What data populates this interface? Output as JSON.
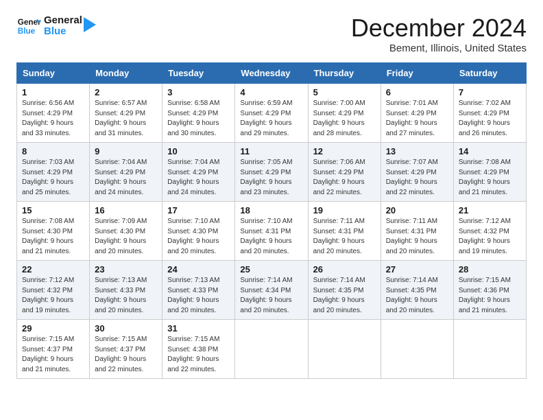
{
  "header": {
    "logo_text_general": "General",
    "logo_text_blue": "Blue",
    "month_title": "December 2024",
    "location": "Bement, Illinois, United States"
  },
  "calendar": {
    "days_of_week": [
      "Sunday",
      "Monday",
      "Tuesday",
      "Wednesday",
      "Thursday",
      "Friday",
      "Saturday"
    ],
    "weeks": [
      [
        {
          "day": "1",
          "info": "Sunrise: 6:56 AM\nSunset: 4:29 PM\nDaylight: 9 hours\nand 33 minutes."
        },
        {
          "day": "2",
          "info": "Sunrise: 6:57 AM\nSunset: 4:29 PM\nDaylight: 9 hours\nand 31 minutes."
        },
        {
          "day": "3",
          "info": "Sunrise: 6:58 AM\nSunset: 4:29 PM\nDaylight: 9 hours\nand 30 minutes."
        },
        {
          "day": "4",
          "info": "Sunrise: 6:59 AM\nSunset: 4:29 PM\nDaylight: 9 hours\nand 29 minutes."
        },
        {
          "day": "5",
          "info": "Sunrise: 7:00 AM\nSunset: 4:29 PM\nDaylight: 9 hours\nand 28 minutes."
        },
        {
          "day": "6",
          "info": "Sunrise: 7:01 AM\nSunset: 4:29 PM\nDaylight: 9 hours\nand 27 minutes."
        },
        {
          "day": "7",
          "info": "Sunrise: 7:02 AM\nSunset: 4:29 PM\nDaylight: 9 hours\nand 26 minutes."
        }
      ],
      [
        {
          "day": "8",
          "info": "Sunrise: 7:03 AM\nSunset: 4:29 PM\nDaylight: 9 hours\nand 25 minutes."
        },
        {
          "day": "9",
          "info": "Sunrise: 7:04 AM\nSunset: 4:29 PM\nDaylight: 9 hours\nand 24 minutes."
        },
        {
          "day": "10",
          "info": "Sunrise: 7:04 AM\nSunset: 4:29 PM\nDaylight: 9 hours\nand 24 minutes."
        },
        {
          "day": "11",
          "info": "Sunrise: 7:05 AM\nSunset: 4:29 PM\nDaylight: 9 hours\nand 23 minutes."
        },
        {
          "day": "12",
          "info": "Sunrise: 7:06 AM\nSunset: 4:29 PM\nDaylight: 9 hours\nand 22 minutes."
        },
        {
          "day": "13",
          "info": "Sunrise: 7:07 AM\nSunset: 4:29 PM\nDaylight: 9 hours\nand 22 minutes."
        },
        {
          "day": "14",
          "info": "Sunrise: 7:08 AM\nSunset: 4:29 PM\nDaylight: 9 hours\nand 21 minutes."
        }
      ],
      [
        {
          "day": "15",
          "info": "Sunrise: 7:08 AM\nSunset: 4:30 PM\nDaylight: 9 hours\nand 21 minutes."
        },
        {
          "day": "16",
          "info": "Sunrise: 7:09 AM\nSunset: 4:30 PM\nDaylight: 9 hours\nand 20 minutes."
        },
        {
          "day": "17",
          "info": "Sunrise: 7:10 AM\nSunset: 4:30 PM\nDaylight: 9 hours\nand 20 minutes."
        },
        {
          "day": "18",
          "info": "Sunrise: 7:10 AM\nSunset: 4:31 PM\nDaylight: 9 hours\nand 20 minutes."
        },
        {
          "day": "19",
          "info": "Sunrise: 7:11 AM\nSunset: 4:31 PM\nDaylight: 9 hours\nand 20 minutes."
        },
        {
          "day": "20",
          "info": "Sunrise: 7:11 AM\nSunset: 4:31 PM\nDaylight: 9 hours\nand 20 minutes."
        },
        {
          "day": "21",
          "info": "Sunrise: 7:12 AM\nSunset: 4:32 PM\nDaylight: 9 hours\nand 19 minutes."
        }
      ],
      [
        {
          "day": "22",
          "info": "Sunrise: 7:12 AM\nSunset: 4:32 PM\nDaylight: 9 hours\nand 19 minutes."
        },
        {
          "day": "23",
          "info": "Sunrise: 7:13 AM\nSunset: 4:33 PM\nDaylight: 9 hours\nand 20 minutes."
        },
        {
          "day": "24",
          "info": "Sunrise: 7:13 AM\nSunset: 4:33 PM\nDaylight: 9 hours\nand 20 minutes."
        },
        {
          "day": "25",
          "info": "Sunrise: 7:14 AM\nSunset: 4:34 PM\nDaylight: 9 hours\nand 20 minutes."
        },
        {
          "day": "26",
          "info": "Sunrise: 7:14 AM\nSunset: 4:35 PM\nDaylight: 9 hours\nand 20 minutes."
        },
        {
          "day": "27",
          "info": "Sunrise: 7:14 AM\nSunset: 4:35 PM\nDaylight: 9 hours\nand 20 minutes."
        },
        {
          "day": "28",
          "info": "Sunrise: 7:15 AM\nSunset: 4:36 PM\nDaylight: 9 hours\nand 21 minutes."
        }
      ],
      [
        {
          "day": "29",
          "info": "Sunrise: 7:15 AM\nSunset: 4:37 PM\nDaylight: 9 hours\nand 21 minutes."
        },
        {
          "day": "30",
          "info": "Sunrise: 7:15 AM\nSunset: 4:37 PM\nDaylight: 9 hours\nand 22 minutes."
        },
        {
          "day": "31",
          "info": "Sunrise: 7:15 AM\nSunset: 4:38 PM\nDaylight: 9 hours\nand 22 minutes."
        },
        {
          "day": "",
          "info": ""
        },
        {
          "day": "",
          "info": ""
        },
        {
          "day": "",
          "info": ""
        },
        {
          "day": "",
          "info": ""
        }
      ]
    ]
  }
}
